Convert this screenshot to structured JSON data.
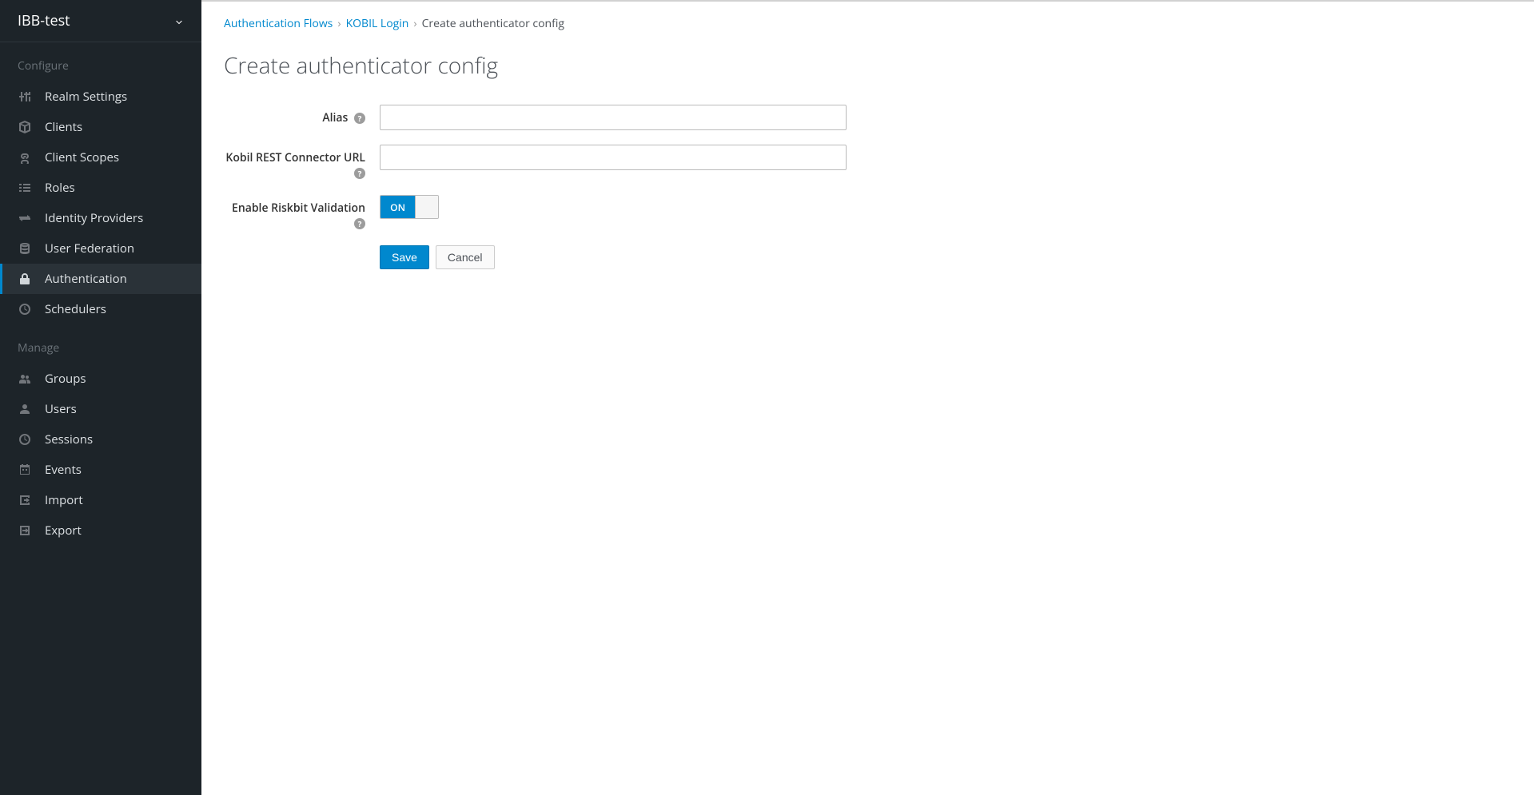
{
  "sidebar": {
    "realm_name": "IBB-test",
    "sections": [
      {
        "title": "Configure",
        "items": [
          {
            "label": "Realm Settings",
            "icon": "sliders-icon",
            "active": false
          },
          {
            "label": "Clients",
            "icon": "cube-icon",
            "active": false
          },
          {
            "label": "Client Scopes",
            "icon": "chain-icon",
            "active": false
          },
          {
            "label": "Roles",
            "icon": "list-icon",
            "active": false
          },
          {
            "label": "Identity Providers",
            "icon": "exchange-icon",
            "active": false
          },
          {
            "label": "User Federation",
            "icon": "database-icon",
            "active": false
          },
          {
            "label": "Authentication",
            "icon": "lock-icon",
            "active": true
          },
          {
            "label": "Schedulers",
            "icon": "clock-icon",
            "active": false
          }
        ]
      },
      {
        "title": "Manage",
        "items": [
          {
            "label": "Groups",
            "icon": "users-icon",
            "active": false
          },
          {
            "label": "Users",
            "icon": "user-icon",
            "active": false
          },
          {
            "label": "Sessions",
            "icon": "clock-icon",
            "active": false
          },
          {
            "label": "Events",
            "icon": "calendar-icon",
            "active": false
          },
          {
            "label": "Import",
            "icon": "import-icon",
            "active": false
          },
          {
            "label": "Export",
            "icon": "export-icon",
            "active": false
          }
        ]
      }
    ]
  },
  "breadcrumb": {
    "items": [
      {
        "label": "Authentication Flows",
        "link": true
      },
      {
        "label": "KOBIL Login",
        "link": true
      },
      {
        "label": "Create authenticator config",
        "link": false
      }
    ]
  },
  "page": {
    "title": "Create authenticator config"
  },
  "form": {
    "fields": [
      {
        "label": "Alias",
        "type": "text",
        "value": "",
        "help": true
      },
      {
        "label": "Kobil REST Connector URL",
        "type": "text",
        "value": "",
        "help": true
      },
      {
        "label": "Enable Riskbit Validation",
        "type": "toggle",
        "value": "ON",
        "help": true
      }
    ],
    "buttons": {
      "save": "Save",
      "cancel": "Cancel"
    }
  }
}
